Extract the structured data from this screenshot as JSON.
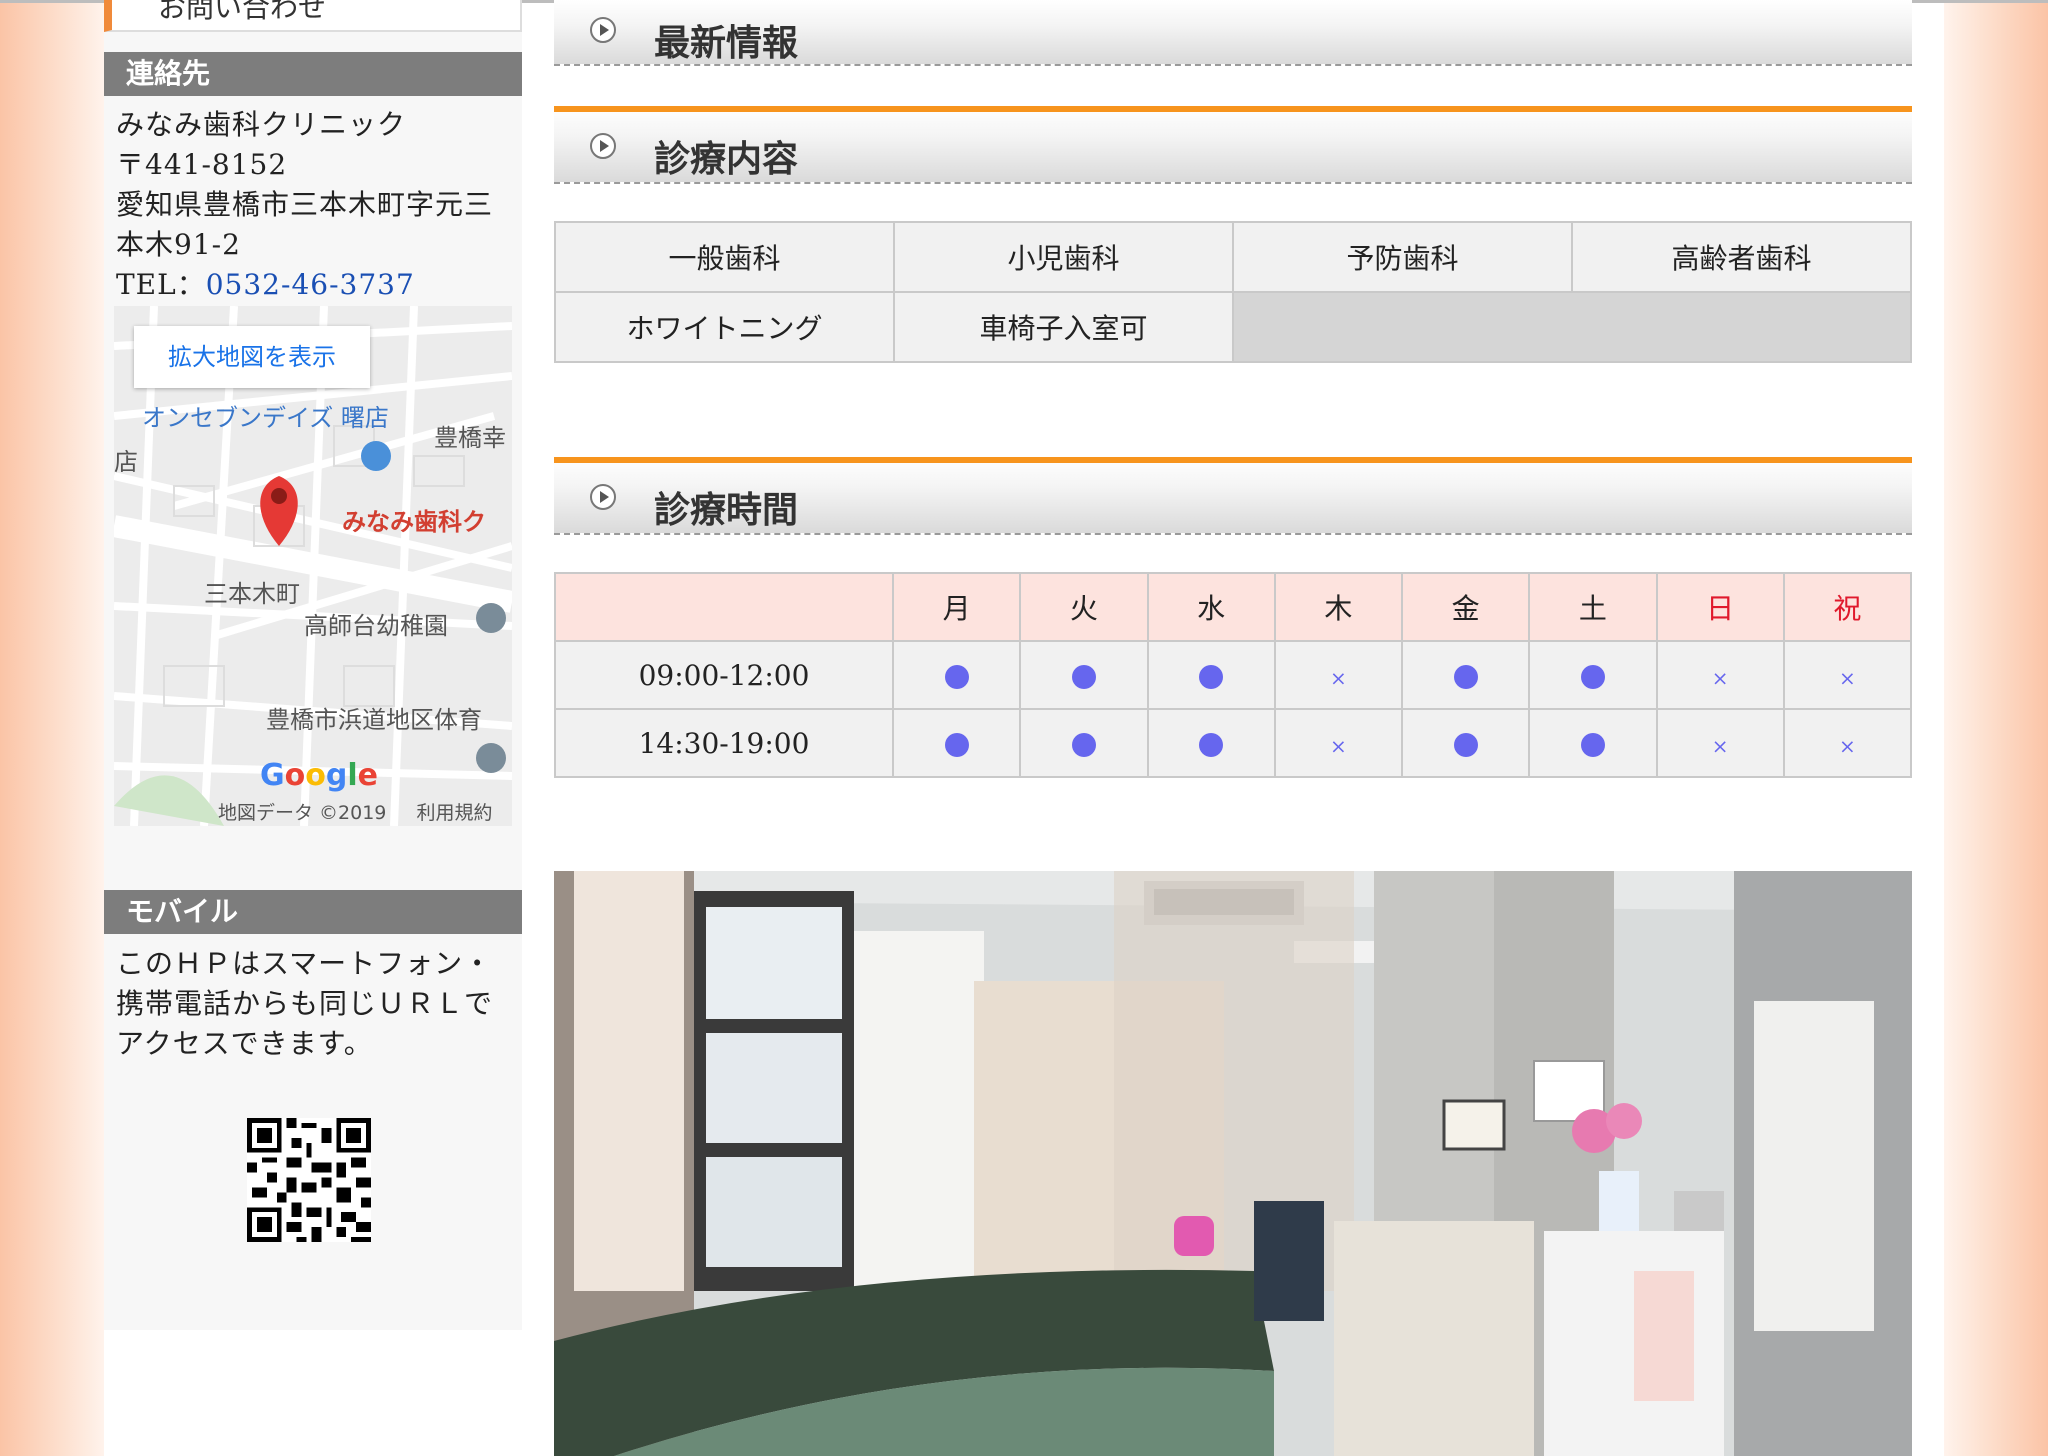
{
  "sidebar": {
    "inquiry_label": "お問い合わせ",
    "contact_heading": "連絡先",
    "clinic_name": "みなみ歯科クリニック",
    "postal": "〒441-8152",
    "address": "愛知県豊橋市三本木町字元三本木91-2",
    "tel_label": "TEL：",
    "tel": "0532-46-3737",
    "map": {
      "enlarge_button": "拡大地図を表示",
      "labels": [
        "オンセブンデイズ 曙店",
        "豊橋幸",
        "店",
        "みなみ歯科ク",
        "三本木町",
        "高師台幼稚園",
        "豊橋市浜道地区体育"
      ],
      "google": "Google",
      "map_data": "地図データ ©2019",
      "terms": "利用規約"
    },
    "mobile_heading": "モバイル",
    "mobile_text": "このＨＰはスマートフォン・携帯電話からも同じＵＲＬでアクセスできます。"
  },
  "sections": {
    "news": "最新情報",
    "services": "診療内容",
    "hours": "診療時間"
  },
  "services": [
    [
      "一般歯科",
      "小児歯科",
      "予防歯科",
      "高齢者歯科"
    ],
    [
      "ホワイトニング",
      "車椅子入室可",
      "",
      ""
    ]
  ],
  "hours": {
    "days": [
      "月",
      "火",
      "水",
      "木",
      "金",
      "土",
      "日",
      "祝"
    ],
    "red_days": [
      "日",
      "祝"
    ],
    "rows": [
      {
        "time": "09:00-12:00",
        "open": [
          true,
          true,
          true,
          false,
          true,
          true,
          false,
          false
        ]
      },
      {
        "time": "14:30-19:00",
        "open": [
          true,
          true,
          true,
          false,
          true,
          true,
          false,
          false
        ]
      }
    ],
    "closed_mark": "×"
  },
  "colors": {
    "accent_orange": "#f7941d",
    "open_dot": "#6666ee",
    "holiday_red": "#e0192c",
    "tel_link": "#1a4fb3"
  }
}
